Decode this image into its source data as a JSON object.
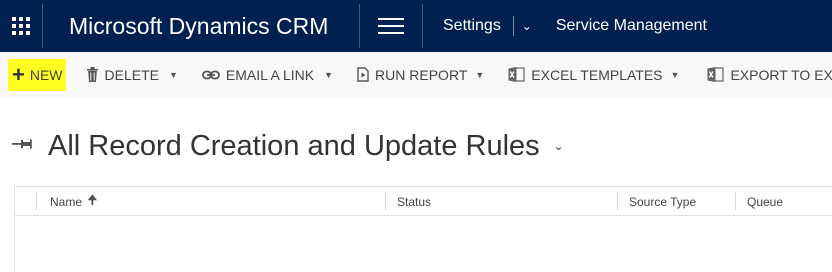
{
  "topnav": {
    "brand": "Microsoft Dynamics CRM",
    "breadcrumb_settings": "Settings",
    "breadcrumb_area": "Service Management",
    "background_color": "#002050"
  },
  "commandbar": {
    "new_label": "NEW",
    "delete_label": "DELETE",
    "email_link_label": "EMAIL A LINK",
    "run_report_label": "RUN REPORT",
    "excel_templates_label": "EXCEL TEMPLATES",
    "export_excel_label": "EXPORT TO EXCEL",
    "highlight_color": "#ffff22"
  },
  "view": {
    "title": "All Record Creation and Update Rules"
  },
  "grid": {
    "columns": [
      "Name",
      "Status",
      "Source Type",
      "Queue"
    ],
    "sort_column": "Name",
    "sort_direction": "ascending",
    "rows": []
  }
}
